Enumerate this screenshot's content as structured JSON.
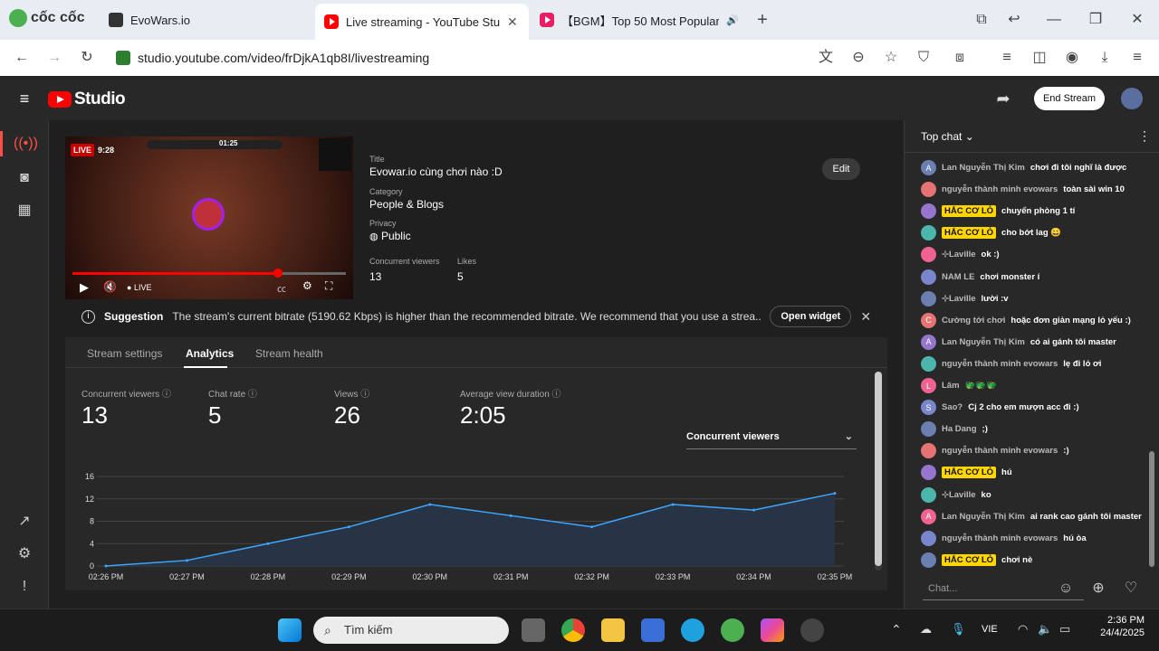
{
  "browser": {
    "brand": "cốc cốc",
    "tabs": [
      {
        "title": "EvoWars.io"
      },
      {
        "title": "Live streaming - YouTube Stu"
      },
      {
        "title": "【BGM】Top 50 Most Popular So"
      }
    ],
    "url": "studio.youtube.com/video/frDjkA1qb8I/livestreaming"
  },
  "header": {
    "logo": "Studio",
    "end_stream": "End Stream"
  },
  "video": {
    "live_badge": "LIVE",
    "elapsed": "9:28",
    "game_timer": "01:25",
    "live_label": "LIVE",
    "progress": 0.75
  },
  "details": {
    "title_label": "Title",
    "title": "Evowar.io cùng chơi nào :D",
    "category_label": "Category",
    "category": "People & Blogs",
    "privacy_label": "Privacy",
    "privacy": "Public",
    "viewers_label": "Concurrent viewers",
    "viewers": "13",
    "likes_label": "Likes",
    "likes": "5",
    "edit": "Edit"
  },
  "suggestion": {
    "label": "Suggestion",
    "text": "The stream's current bitrate (5190.62 Kbps) is higher than the recommended bitrate. We recommend that you use a strea...",
    "open_widget": "Open widget"
  },
  "tabs": [
    "Stream settings",
    "Analytics",
    "Stream health"
  ],
  "metrics": [
    {
      "label": "Concurrent viewers",
      "value": "13"
    },
    {
      "label": "Chat rate",
      "value": "5"
    },
    {
      "label": "Views",
      "value": "26"
    },
    {
      "label": "Average view duration",
      "value": "2:05"
    }
  ],
  "chart_select": "Concurrent viewers",
  "chart_data": {
    "type": "area",
    "x": [
      "02:26 PM",
      "02:27 PM",
      "02:28 PM",
      "02:29 PM",
      "02:30 PM",
      "02:31 PM",
      "02:32 PM",
      "02:33 PM",
      "02:34 PM",
      "02:35 PM"
    ],
    "y_ticks": [
      "16",
      "12",
      "8",
      "4",
      "0"
    ],
    "series": [
      {
        "values": [
          0,
          1,
          4,
          7,
          11,
          9,
          7,
          11,
          10,
          13
        ]
      }
    ],
    "ylim": [
      0,
      16
    ],
    "grid": true,
    "colors": {
      "line": "#3ea6ff",
      "fill": "#263548"
    }
  },
  "chat": {
    "header": "Top chat",
    "placeholder": "Chat...",
    "messages": [
      {
        "name": "Lan Nguyễn Thị Kim",
        "text": "chơi đi tôi nghĩ là được",
        "badge": false,
        "av": "A"
      },
      {
        "name": "nguyễn thành minh evowars",
        "text": "toàn sài win 10",
        "badge": false,
        "av": ""
      },
      {
        "name": "HẮC CƠ LỎ",
        "text": "chuyển phòng 1 tí",
        "badge": true,
        "av": ""
      },
      {
        "name": "HẮC CƠ LỎ",
        "text": "cho bớt lag 😀",
        "badge": true,
        "av": ""
      },
      {
        "name": "⊹Laville",
        "text": "ok :)",
        "badge": false,
        "av": ""
      },
      {
        "name": "NAM LE",
        "text": "chơi monster í",
        "badge": false,
        "av": ""
      },
      {
        "name": "⊹Laville",
        "text": "lười :v",
        "badge": false,
        "av": ""
      },
      {
        "name": "Cường tới chơi",
        "text": "hoặc đơn giản mạng lỏ yếu :)",
        "badge": false,
        "av": "C"
      },
      {
        "name": "Lan Nguyễn Thị Kim",
        "text": "có ai gánh tôi master",
        "badge": false,
        "av": "A"
      },
      {
        "name": "nguyễn thành minh evowars",
        "text": "lẹ đi lỏ ơi",
        "badge": false,
        "av": ""
      },
      {
        "name": "Lâm",
        "text": "🐲🐲🐲",
        "badge": false,
        "av": "L"
      },
      {
        "name": "Sao?",
        "text": "Cj 2 cho em mượn acc đi :)",
        "badge": false,
        "av": "S"
      },
      {
        "name": "Ha Dang",
        "text": ";)",
        "badge": false,
        "av": ""
      },
      {
        "name": "nguyễn thành minh evowars",
        "text": ":)",
        "badge": false,
        "av": ""
      },
      {
        "name": "HẮC CƠ LỎ",
        "text": "hú",
        "badge": true,
        "av": ""
      },
      {
        "name": "⊹Laville",
        "text": "ko",
        "badge": false,
        "av": ""
      },
      {
        "name": "Lan Nguyễn Thị Kim",
        "text": "ai rank cao gánh tôi master",
        "badge": false,
        "av": "A"
      },
      {
        "name": "nguyễn thành minh evowars",
        "text": "hú òa",
        "badge": false,
        "av": ""
      },
      {
        "name": "HẮC CƠ LỎ",
        "text": "chơi nè",
        "badge": true,
        "av": ""
      }
    ]
  },
  "taskbar": {
    "search": "Tìm kiếm",
    "lang": "VIE",
    "time": "2:36 PM",
    "date": "24/4/2025"
  }
}
